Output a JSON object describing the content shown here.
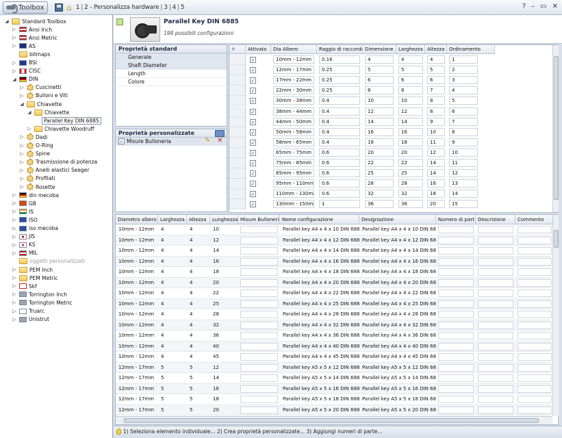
{
  "titlebar": {
    "app_label": "Toolbox",
    "crumbs": [
      "1",
      "2 - Personalizza hardware",
      "3",
      "4",
      "5"
    ],
    "controls": [
      "?",
      "–",
      "▭",
      "✕"
    ]
  },
  "tree": [
    {
      "label": "Standard Toolbox",
      "lvl": 0,
      "tog": "◢",
      "ico": "fold"
    },
    {
      "label": "Ansi Inch",
      "lvl": 1,
      "tog": "▷",
      "ico": "us"
    },
    {
      "label": "Ansi Metric",
      "lvl": 1,
      "tog": "▷",
      "ico": "us"
    },
    {
      "label": "AS",
      "lvl": 1,
      "tog": "▷",
      "ico": "au"
    },
    {
      "label": "bitmaps",
      "lvl": 1,
      "tog": "",
      "ico": "fold"
    },
    {
      "label": "BSI",
      "lvl": 1,
      "tog": "▷",
      "ico": "gb"
    },
    {
      "label": "CISC",
      "lvl": 1,
      "tog": "▷",
      "ico": "ca"
    },
    {
      "label": "DIN",
      "lvl": 1,
      "tog": "◢",
      "ico": "de"
    },
    {
      "label": "Cuscinetti",
      "lvl": 2,
      "tog": "▷",
      "ico": "gear"
    },
    {
      "label": "Bulloni e Viti",
      "lvl": 2,
      "tog": "▷",
      "ico": "gear"
    },
    {
      "label": "Chiavette",
      "lvl": 2,
      "tog": "◢",
      "ico": "fold"
    },
    {
      "label": "Chiavette",
      "lvl": 3,
      "tog": "◢",
      "ico": "fold"
    },
    {
      "label": "Parallel Key DIN 6885",
      "lvl": 4,
      "tog": "",
      "ico": "none",
      "sel": true
    },
    {
      "label": "Chiavette Woodruff",
      "lvl": 3,
      "tog": "▷",
      "ico": "fold"
    },
    {
      "label": "Dadi",
      "lvl": 2,
      "tog": "▷",
      "ico": "gear"
    },
    {
      "label": "O-Ring",
      "lvl": 2,
      "tog": "▷",
      "ico": "gear"
    },
    {
      "label": "Spine",
      "lvl": 2,
      "tog": "▷",
      "ico": "gear"
    },
    {
      "label": "Trasmissione di potenza",
      "lvl": 2,
      "tog": "▷",
      "ico": "gear"
    },
    {
      "label": "Anelli elastici Seeger",
      "lvl": 2,
      "tog": "▷",
      "ico": "gear"
    },
    {
      "label": "Profilati",
      "lvl": 2,
      "tog": "▷",
      "ico": "gear"
    },
    {
      "label": "Rosette",
      "lvl": 2,
      "tog": "▷",
      "ico": "gear"
    },
    {
      "label": "din mecoba",
      "lvl": 1,
      "tog": "▷",
      "ico": "de"
    },
    {
      "label": "GB",
      "lvl": 1,
      "tog": "▷",
      "ico": "cn"
    },
    {
      "label": "IS",
      "lvl": 1,
      "tog": "▷",
      "ico": "in"
    },
    {
      "label": "ISO",
      "lvl": 1,
      "tog": "▷",
      "ico": "iso"
    },
    {
      "label": "iso mecoba",
      "lvl": 1,
      "tog": "▷",
      "ico": "iso"
    },
    {
      "label": "JIS",
      "lvl": 1,
      "tog": "▷",
      "ico": "jp"
    },
    {
      "label": "KS",
      "lvl": 1,
      "tog": "▷",
      "ico": "kr"
    },
    {
      "label": "MIL",
      "lvl": 1,
      "tog": "▷",
      "ico": "us"
    },
    {
      "label": "oggetti personalizzati",
      "lvl": 1,
      "tog": "",
      "ico": "fold",
      "dim": true
    },
    {
      "label": "PEM Inch",
      "lvl": 1,
      "tog": "▷",
      "ico": "fold"
    },
    {
      "label": "PEM Metric",
      "lvl": 1,
      "tog": "▷",
      "ico": "fold"
    },
    {
      "label": "Skf",
      "lvl": 1,
      "tog": "▷",
      "ico": "skf"
    },
    {
      "label": "Torrington Inch",
      "lvl": 1,
      "tog": "▷",
      "ico": "tor"
    },
    {
      "label": "Torrington Metric",
      "lvl": 1,
      "tog": "▷",
      "ico": "tor"
    },
    {
      "label": "Truarc",
      "lvl": 1,
      "tog": "▷",
      "ico": "tru"
    },
    {
      "label": "Unistrut",
      "lvl": 1,
      "tog": "▷",
      "ico": "uni"
    }
  ],
  "header": {
    "title": "Parallel Key DIN 6885",
    "subtitle": "198 possibili configurazioni"
  },
  "std_props": {
    "title": "Proprietà standard",
    "items": [
      "Generale",
      "Shaft Diameter",
      "Length",
      "Colore"
    ]
  },
  "custom_props": {
    "title": "Proprietà personalizzate",
    "items": [
      "Misure Bulloneria"
    ]
  },
  "config": {
    "headers": [
      "Attivato",
      "Dia Albero",
      "Raggio di raccordo",
      "Dimensione",
      "Larghezza",
      "Altezza",
      "Ordinamento"
    ],
    "rows": [
      [
        "10mm - 12mm",
        "0.16",
        "4",
        "4",
        "4",
        "1"
      ],
      [
        "12mm - 17mm",
        "0.25",
        "5",
        "5",
        "5",
        "2"
      ],
      [
        "17mm - 22mm",
        "0.25",
        "6",
        "6",
        "6",
        "3"
      ],
      [
        "22mm - 30mm",
        "0.25",
        "8",
        "8",
        "7",
        "4"
      ],
      [
        "30mm - 38mm",
        "0.4",
        "10",
        "10",
        "8",
        "5"
      ],
      [
        "38mm - 44mm",
        "0.4",
        "12",
        "12",
        "8",
        "6"
      ],
      [
        "44mm - 50mm",
        "0.4",
        "14",
        "14",
        "9",
        "7"
      ],
      [
        "50mm - 58mm",
        "0.4",
        "16",
        "16",
        "10",
        "8"
      ],
      [
        "58mm - 65mm",
        "0.4",
        "18",
        "18",
        "11",
        "9"
      ],
      [
        "65mm - 75mm",
        "0.6",
        "20",
        "20",
        "12",
        "10"
      ],
      [
        "75mm - 85mm",
        "0.6",
        "22",
        "22",
        "14",
        "11"
      ],
      [
        "85mm - 95mm",
        "0.6",
        "25",
        "25",
        "14",
        "12"
      ],
      [
        "95mm - 110mm",
        "0.6",
        "28",
        "28",
        "16",
        "13"
      ],
      [
        "110mm - 130mm",
        "0.6",
        "32",
        "32",
        "18",
        "14"
      ],
      [
        "130mm - 150mm",
        "1",
        "36",
        "36",
        "20",
        "15"
      ]
    ]
  },
  "results": {
    "headers": [
      "Diametro albero",
      "Larghezza",
      "Altezza",
      "Lunghezza",
      "Misure Bulloneria",
      "Nome configurazione",
      "Designazione",
      "Numero di part",
      "Descrizione",
      "Commento"
    ],
    "rows": [
      [
        "10mm - 12mm",
        "4",
        "4",
        "10",
        "Parallel key A4 x 4 x 10 DIN 6885"
      ],
      [
        "10mm - 12mm",
        "4",
        "4",
        "12",
        "Parallel key A4 x 4 x 12 DIN 6885"
      ],
      [
        "10mm - 12mm",
        "4",
        "4",
        "14",
        "Parallel key A4 x 4 x 14 DIN 6885"
      ],
      [
        "10mm - 12mm",
        "4",
        "4",
        "16",
        "Parallel key A4 x 4 x 16 DIN 6885"
      ],
      [
        "10mm - 12mm",
        "4",
        "4",
        "18",
        "Parallel key A4 x 4 x 18 DIN 6885"
      ],
      [
        "10mm - 12mm",
        "4",
        "4",
        "20",
        "Parallel key A4 x 4 x 20 DIN 6885"
      ],
      [
        "10mm - 12mm",
        "4",
        "4",
        "22",
        "Parallel key A4 x 4 x 22 DIN 6885"
      ],
      [
        "10mm - 12mm",
        "4",
        "4",
        "25",
        "Parallel key A4 x 4 x 25 DIN 6885"
      ],
      [
        "10mm - 12mm",
        "4",
        "4",
        "28",
        "Parallel key A4 x 4 x 28 DIN 6885"
      ],
      [
        "10mm - 12mm",
        "4",
        "4",
        "32",
        "Parallel key A4 x 4 x 32 DIN 6885"
      ],
      [
        "10mm - 12mm",
        "4",
        "4",
        "36",
        "Parallel key A4 x 4 x 36 DIN 6885"
      ],
      [
        "10mm - 12mm",
        "4",
        "4",
        "40",
        "Parallel key A4 x 4 x 40 DIN 6885"
      ],
      [
        "10mm - 12mm",
        "4",
        "4",
        "45",
        "Parallel key A4 x 4 x 45 DIN 6885"
      ],
      [
        "12mm - 17mm",
        "5",
        "5",
        "12",
        "Parallel key A5 x 5 x 12 DIN 6885"
      ],
      [
        "12mm - 17mm",
        "5",
        "5",
        "14",
        "Parallel key A5 x 5 x 14 DIN 6885"
      ],
      [
        "12mm - 17mm",
        "5",
        "5",
        "16",
        "Parallel key A5 x 5 x 16 DIN 6885"
      ],
      [
        "12mm - 17mm",
        "5",
        "5",
        "18",
        "Parallel key A5 x 5 x 18 DIN 6885"
      ],
      [
        "12mm - 17mm",
        "5",
        "5",
        "20",
        "Parallel key A5 x 5 x 20 DIN 6885"
      ]
    ]
  },
  "status": {
    "text": "1) Seleziona elemento individuale... 2) Crea proprietà personalizzate... 3) Aggiungi numeri di parte..."
  }
}
